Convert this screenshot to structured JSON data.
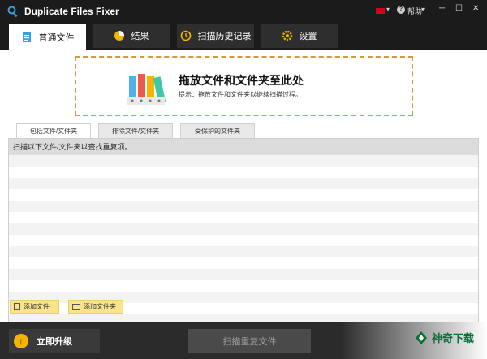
{
  "app": {
    "title": "Duplicate Files Fixer"
  },
  "titlebar": {
    "help_label": "帮助",
    "flag_caret": "▾",
    "help_caret": "▾",
    "help_icon_glyph": "?",
    "minimize": "─",
    "maximize": "☐",
    "close": "✕"
  },
  "tabs": [
    {
      "label": "普通文件",
      "icon": "document-icon",
      "active": true
    },
    {
      "label": "结果",
      "icon": "pie-chart-icon",
      "active": false
    },
    {
      "label": "扫描历史记录",
      "icon": "history-icon",
      "active": false
    },
    {
      "label": "设置",
      "icon": "gear-icon",
      "active": false
    }
  ],
  "dropzone": {
    "title": "拖放文件和文件夹至此处",
    "hint": "提示：拖放文件和文件夹以继续扫描过程。"
  },
  "subtabs": [
    {
      "label": "包括文件/文件夹",
      "active": true
    },
    {
      "label": "排除文件/文件夹",
      "active": false
    },
    {
      "label": "受保护的文件夹",
      "active": false
    }
  ],
  "list": {
    "header": "扫描以下文件/文件夹以查找重复项。"
  },
  "actions": {
    "add_file": "添加文件",
    "add_folder": "添加文件夹"
  },
  "footer": {
    "upgrade_label": "立即升级",
    "upgrade_glyph": "↑",
    "scan_label": "扫描重复文件",
    "watermark": "神奇下载"
  },
  "colors": {
    "titlebar": "#1b1b1b",
    "accent_border": "#d39b3b",
    "add_button": "#f7e48b",
    "upgrade_circle": "#f4b400",
    "watermark": "#0b6f3a"
  }
}
